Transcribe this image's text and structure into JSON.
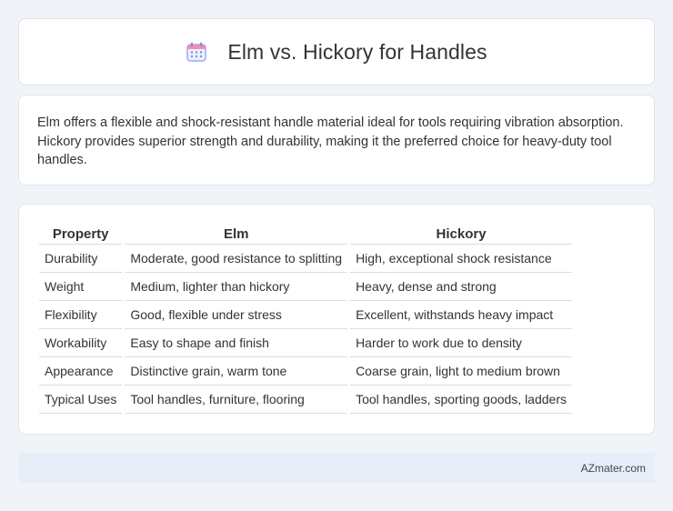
{
  "header": {
    "title": "Elm vs. Hickory for Handles",
    "icon": "calendar-icon",
    "icon_color": "#7b8ef0"
  },
  "summary": {
    "text": "Elm offers a flexible and shock-resistant handle material ideal for tools requiring vibration absorption. Hickory provides superior strength and durability, making it the preferred choice for heavy-duty tool handles."
  },
  "table": {
    "headers": [
      "Property",
      "Elm",
      "Hickory"
    ],
    "rows": [
      [
        "Durability",
        "Moderate, good resistance to splitting",
        "High, exceptional shock resistance"
      ],
      [
        "Weight",
        "Medium, lighter than hickory",
        "Heavy, dense and strong"
      ],
      [
        "Flexibility",
        "Good, flexible under stress",
        "Excellent, withstands heavy impact"
      ],
      [
        "Workability",
        "Easy to shape and finish",
        "Harder to work due to density"
      ],
      [
        "Appearance",
        "Distinctive grain, warm tone",
        "Coarse grain, light to medium brown"
      ],
      [
        "Typical Uses",
        "Tool handles, furniture, flooring",
        "Tool handles, sporting goods, ladders"
      ]
    ]
  },
  "footer": {
    "brand": "AZmater.com"
  }
}
